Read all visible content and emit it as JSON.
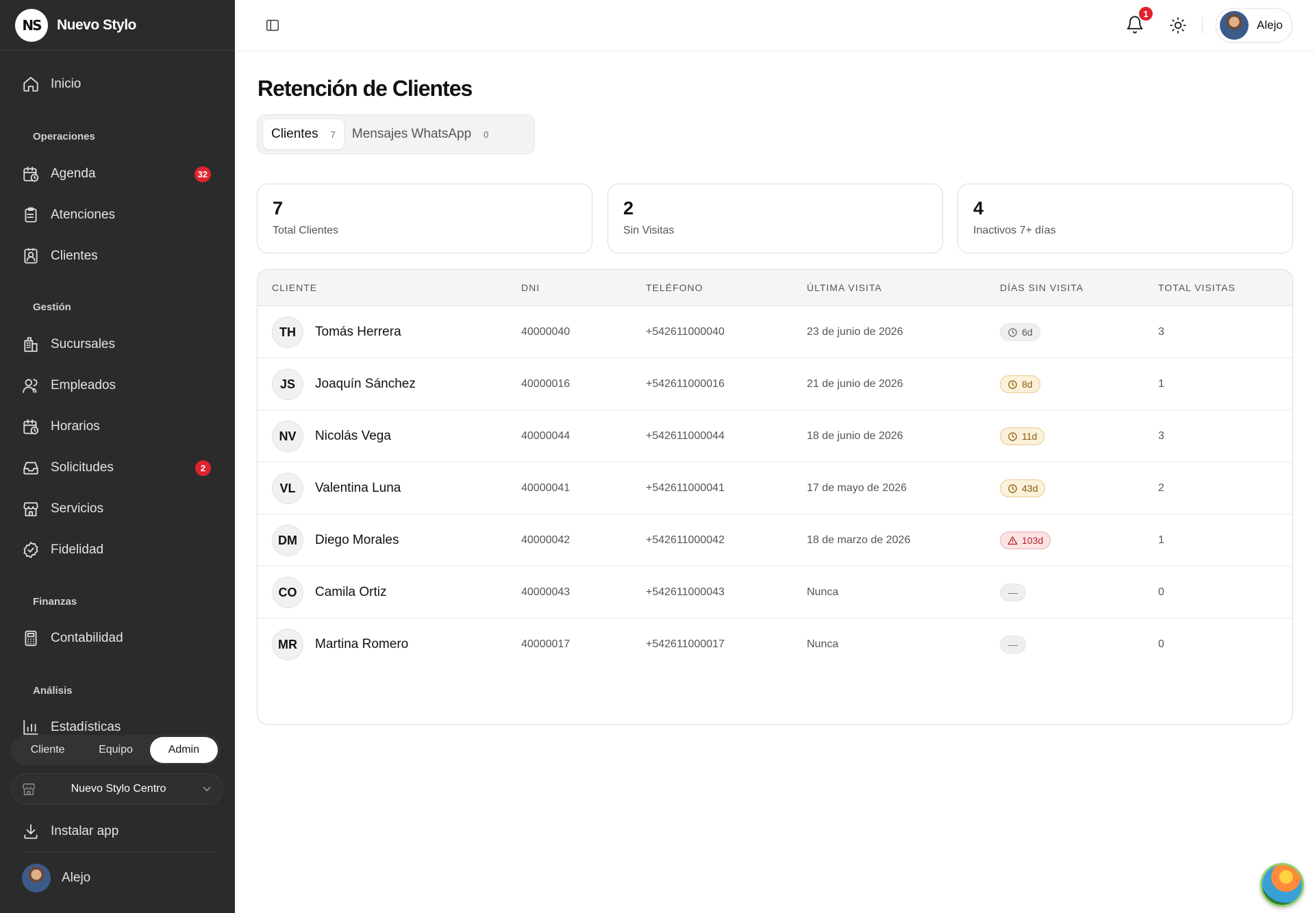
{
  "brand": {
    "name": "Nuevo Stylo",
    "logo_text": "NS"
  },
  "sidebar": {
    "home": {
      "label": "Inicio",
      "icon": "home-icon"
    },
    "sections": [
      {
        "title": "Operaciones"
      },
      {
        "title": "Gestión"
      },
      {
        "title": "Finanzas"
      },
      {
        "title": "Análisis"
      }
    ],
    "items": [
      {
        "label": "Agenda",
        "icon": "calendar-clock-icon",
        "badge": "32"
      },
      {
        "label": "Atenciones",
        "icon": "clipboard-icon"
      },
      {
        "label": "Clientes",
        "icon": "contact-icon"
      },
      {
        "label": "Sucursales",
        "icon": "building-icon"
      },
      {
        "label": "Empleados",
        "icon": "users-icon"
      },
      {
        "label": "Horarios",
        "icon": "calendar-clock-icon"
      },
      {
        "label": "Solicitudes",
        "icon": "inbox-icon",
        "badge": "2"
      },
      {
        "label": "Servicios",
        "icon": "store-icon"
      },
      {
        "label": "Fidelidad",
        "icon": "badge-check-icon"
      },
      {
        "label": "Contabilidad",
        "icon": "calculator-icon"
      },
      {
        "label": "Estadísticas",
        "icon": "bar-chart-icon"
      }
    ],
    "roles": [
      "Cliente",
      "Equipo",
      "Admin"
    ],
    "active_role": "Admin",
    "branch": "Nuevo Stylo Centro",
    "install_label": "Instalar app",
    "user_name": "Alejo"
  },
  "topbar": {
    "notification_count": "1",
    "user_name": "Alejo"
  },
  "page": {
    "title": "Retención de Clientes",
    "tabs": [
      {
        "label": "Clientes",
        "count": "7"
      },
      {
        "label": "Mensajes WhatsApp",
        "count": "0"
      }
    ],
    "stats": [
      {
        "value": "7",
        "label": "Total Clientes"
      },
      {
        "value": "2",
        "label": "Sin Visitas"
      },
      {
        "value": "4",
        "label": "Inactivos 7+ días"
      }
    ],
    "table": {
      "headers": [
        "CLIENTE",
        "DNI",
        "TELÉFONO",
        "ÚLTIMA VISITA",
        "DÍAS SIN VISITA",
        "TOTAL VISITAS"
      ],
      "rows": [
        {
          "initials": "TH",
          "name": "Tomás Herrera",
          "dni": "40000040",
          "phone": "+542611000040",
          "last_visit": "23 de junio de 2026",
          "days": "6d",
          "status": "gray",
          "total": "3"
        },
        {
          "initials": "JS",
          "name": "Joaquín Sánchez",
          "dni": "40000016",
          "phone": "+542611000016",
          "last_visit": "21 de junio de 2026",
          "days": "8d",
          "status": "amber",
          "total": "1"
        },
        {
          "initials": "NV",
          "name": "Nicolás Vega",
          "dni": "40000044",
          "phone": "+542611000044",
          "last_visit": "18 de junio de 2026",
          "days": "11d",
          "status": "amber",
          "total": "3"
        },
        {
          "initials": "VL",
          "name": "Valentina Luna",
          "dni": "40000041",
          "phone": "+542611000041",
          "last_visit": "17 de mayo de 2026",
          "days": "43d",
          "status": "amber",
          "total": "2"
        },
        {
          "initials": "DM",
          "name": "Diego Morales",
          "dni": "40000042",
          "phone": "+542611000042",
          "last_visit": "18 de marzo de 2026",
          "days": "103d",
          "status": "red",
          "total": "1"
        },
        {
          "initials": "CO",
          "name": "Camila Ortiz",
          "dni": "40000043",
          "phone": "+542611000043",
          "last_visit": "Nunca",
          "days": "—",
          "status": "none",
          "total": "0"
        },
        {
          "initials": "MR",
          "name": "Martina Romero",
          "dni": "40000017",
          "phone": "+542611000017",
          "last_visit": "Nunca",
          "days": "—",
          "status": "none",
          "total": "0"
        }
      ]
    }
  },
  "colors": {
    "sidebar_bg": "#2b2b2b",
    "badge_red": "#e0232e",
    "amber": "#8a5a08",
    "danger": "#b4202a"
  }
}
